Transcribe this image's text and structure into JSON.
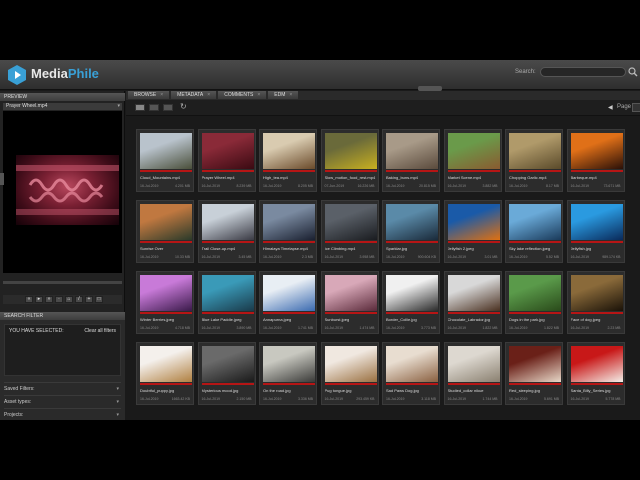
{
  "app": {
    "brand_name": "Media",
    "brand_accent": "Phile",
    "accent_color": "#39a0d6"
  },
  "header": {
    "search_label": "Search:",
    "search_placeholder": ""
  },
  "sidebar": {
    "preview_title": "PREVIEW",
    "current_file": "Prayer Wheel.mp4",
    "search_filter_title": "SEARCH FILTER",
    "you_have_selected": "YOU HAVE SELECTED:",
    "clear_all": "Clear all filters",
    "filters": [
      {
        "label": "Saved Filters:"
      },
      {
        "label": "Asset types:"
      },
      {
        "label": "Projects:"
      }
    ]
  },
  "tabs": [
    {
      "label": "BROWSE"
    },
    {
      "label": "METADATA"
    },
    {
      "label": "COMMENTS"
    },
    {
      "label": "EDM"
    }
  ],
  "toolbar": {
    "page_label": "Page"
  },
  "assets": [
    {
      "name": "Cloud_Mountains.mp4",
      "date": "16-Jul-2019",
      "size": "4.201 MB",
      "c1": "#b9c3cc",
      "c2": "#4a4f3a"
    },
    {
      "name": "Prayer Wheel.mp4",
      "date": "16-Jul-2019",
      "size": "8.239 MB",
      "c1": "#8a2a38",
      "c2": "#3a0a12"
    },
    {
      "name": "High_tea.mp4",
      "date": "16-Jul-2019",
      "size": "8.205 MB",
      "c1": "#d9cbb0",
      "c2": "#6a4a2a"
    },
    {
      "name": "Slow_motion_food_rest.mp4",
      "date": "07-Jun-2019",
      "size": "16.226 MB",
      "c1": "#6a6a3a",
      "c2": "#c8b020"
    },
    {
      "name": "Baking_buns.mp4",
      "date": "16-Jul-2019",
      "size": "20.815 MB",
      "c1": "#a89a88",
      "c2": "#5a4a3c"
    },
    {
      "name": "Market Scene.mp4",
      "date": "16-Jul-2019",
      "size": "3.882 MB",
      "c1": "#6a9a4a",
      "c2": "#8a5a30"
    },
    {
      "name": "Chopping Garlic.mp4",
      "date": "16-Jul-2019",
      "size": "8.17 MB",
      "c1": "#b09a6a",
      "c2": "#5a4a2a"
    },
    {
      "name": "Barbeque.mp4",
      "date": "16-Jul-2019",
      "size": "73.671 MB",
      "c1": "#e07018",
      "c2": "#2a1008"
    },
    {
      "name": "Sunrise Over",
      "date": "16-Jul-2019",
      "size": "10.33 MB",
      "c1": "#c07840",
      "c2": "#2a3a2a"
    },
    {
      "name": "Trail Close-up.mp4",
      "date": "16-Jul-2019",
      "size": "3.45 MB",
      "c1": "#c8d0d8",
      "c2": "#3a3a44"
    },
    {
      "name": "Himalaya Timelapse.mp4",
      "date": "16-Jul-2019",
      "size": "2.3 MB",
      "c1": "#7a8aa0",
      "c2": "#1a2030"
    },
    {
      "name": "Ice Climbing.mp4",
      "date": "16-Jul-2019",
      "size": "3.958 MB",
      "c1": "#5a6068",
      "c2": "#1a1c20"
    },
    {
      "name": "Sparklar.jpg",
      "date": "16-Jul-2019",
      "size": "900.604 KB",
      "c1": "#5a8aa8",
      "c2": "#1a2a3a"
    },
    {
      "name": "Jellyfish 2.jpeg",
      "date": "16-Jul-2019",
      "size": "3.01 MB",
      "c1": "#1a5aa8",
      "c2": "#e07010"
    },
    {
      "name": "Sky lake reflection.jpeg",
      "date": "16-Jul-2019",
      "size": "5.52 MB",
      "c1": "#6aaad8",
      "c2": "#1a3a5a"
    },
    {
      "name": "Jellyfish.jpg",
      "date": "16-Jul-2019",
      "size": "989.174 KB",
      "c1": "#2a9ae0",
      "c2": "#0a2a5a"
    },
    {
      "name": "Winter Berries.jpeg",
      "date": "16-Jul-2019",
      "size": "4.718 MB",
      "c1": "#c87ad8",
      "c2": "#3a1a4a"
    },
    {
      "name": "Blue Lake Paddle.jpeg",
      "date": "16-Jul-2019",
      "size": "3.890 MB",
      "c1": "#3a9ab8",
      "c2": "#1a3a4a"
    },
    {
      "name": "Annapurna.jpeg",
      "date": "16-Jul-2019",
      "size": "1.741 MB",
      "c1": "#e8eef4",
      "c2": "#3a6ab0"
    },
    {
      "name": "Sunburst.jpeg",
      "date": "16-Jul-2019",
      "size": "1.474 MB",
      "c1": "#d8a8b8",
      "c2": "#5a2a3a"
    },
    {
      "name": "Border_Collie.jpg",
      "date": "16-Jul-2019",
      "size": "3.773 MB",
      "c1": "#f0f0f0",
      "c2": "#2a2a2a"
    },
    {
      "name": "Chocolate_Labrador.jpg",
      "date": "16-Jul-2019",
      "size": "1.822 MB",
      "c1": "#d8d8d8",
      "c2": "#4a3020"
    },
    {
      "name": "Dogs in the park.jpg",
      "date": "16-Jul-2019",
      "size": "1.822 MB",
      "c1": "#5a9a4a",
      "c2": "#2a4a1a"
    },
    {
      "name": "Face of dog.jpeg",
      "date": "16-Jul-2019",
      "size": "2.23 MB",
      "c1": "#8a6a3a",
      "c2": "#1a1208"
    },
    {
      "name": "Doubtful_puppy.jpg",
      "date": "16-Jul-2019",
      "size": "1663.42 KB",
      "c1": "#f4f0ec",
      "c2": "#b08040"
    },
    {
      "name": "Mysterious mood.jpg",
      "date": "16-Jul-2019",
      "size": "2.150 MB",
      "c1": "#6a6a6a",
      "c2": "#1a1a1a"
    },
    {
      "name": "On the road.jpg",
      "date": "16-Jul-2019",
      "size": "3.336 MB",
      "c1": "#c8c8c0",
      "c2": "#3a3a38"
    },
    {
      "name": "Pug tongue.jpg",
      "date": "16-Jul-2019",
      "size": "293.459 KB",
      "c1": "#f0e8e0",
      "c2": "#9a7040"
    },
    {
      "name": "Sad Paws Dog.jpg",
      "date": "16-Jul-2019",
      "size": "3.118 MB",
      "c1": "#e8ddd0",
      "c2": "#8a6040"
    },
    {
      "name": "Studied_collar nikue",
      "date": "16-Jul-2019",
      "size": "1.744 MB",
      "c1": "#ddd8d0",
      "c2": "#8a8070"
    },
    {
      "name": "Red_sleeping.jpg",
      "date": "16-Jul-2019",
      "size": "5.691 MB",
      "c1": "#6a2018",
      "c2": "#e8d8c8"
    },
    {
      "name": "Santa_Billy_Series.jpg",
      "date": "16-Jul-2019",
      "size": "5.778 MB",
      "c1": "#c81818",
      "c2": "#f4eee8"
    }
  ]
}
